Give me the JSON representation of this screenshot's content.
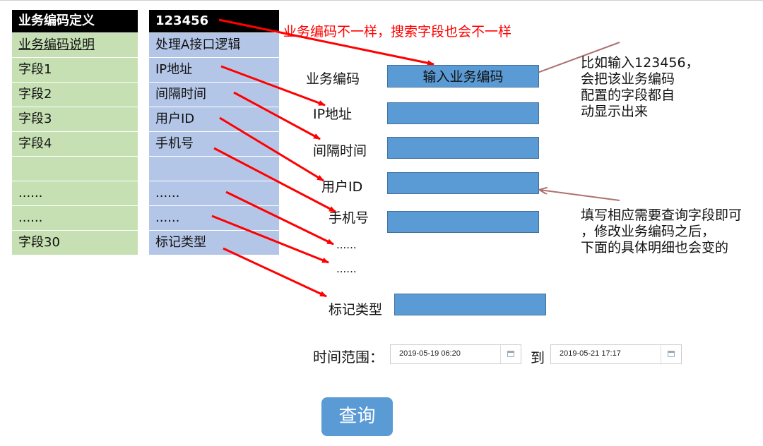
{
  "left_table": {
    "header": "业务编码定义",
    "rows": [
      "业务编码说明",
      "字段1",
      "字段2",
      "字段3",
      "字段4",
      "",
      "......",
      "......",
      "字段30"
    ]
  },
  "mid_table": {
    "header": "123456",
    "rows": [
      "处理A接口逻辑",
      "IP地址",
      "间隔时间",
      "用户ID",
      "手机号",
      "",
      "......",
      "......",
      "标记类型"
    ]
  },
  "red_note": "业务编码不一样，搜索字段也会不一样",
  "form": {
    "business_code_label": "业务编码",
    "business_code_placeholder": "输入业务编码",
    "ip_label": "IP地址",
    "interval_label": "间隔时间",
    "userid_label": "用户ID",
    "phone_label": "手机号",
    "ellipsis1": "......",
    "ellipsis2": "......",
    "mark_type_label": "标记类型",
    "time_range_label": "时间范围：",
    "start_time": "2019-05-19 06:20",
    "to_label": "到",
    "end_time": "2019-05-21 17:17",
    "query_button": "查询"
  },
  "notes": {
    "note1": [
      "比如输入123456，",
      "会把该业务编码",
      "配置的字段都自",
      "动显示出来"
    ],
    "note2": [
      "填写相应需要查询字段即可",
      "，修改业务编码之后，",
      "下面的具体明细也会变的"
    ]
  },
  "colors": {
    "left_fill": "#c6e0b4",
    "mid_fill": "#b4c6e7",
    "field_fill": "#5b9bd5",
    "arrow_red": "#ff0000",
    "arrow_brown": "#b07070"
  }
}
